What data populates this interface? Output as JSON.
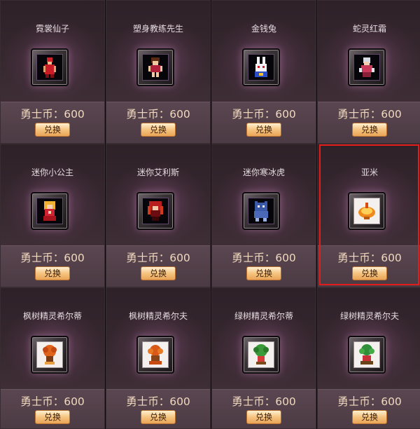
{
  "items": [
    {
      "name": "霓裳仙子",
      "price": "勇士币：600",
      "button": "兑换",
      "icon": "fairy-sprite-icon",
      "light": false
    },
    {
      "name": "塑身教练先生",
      "price": "勇士币：600",
      "button": "兑换",
      "icon": "coach-sprite-icon",
      "light": false
    },
    {
      "name": "金钱兔",
      "price": "勇士币：600",
      "button": "兑换",
      "icon": "rabbit-sprite-icon",
      "light": false
    },
    {
      "name": "蛇灵红霜",
      "price": "勇士币：600",
      "button": "兑换",
      "icon": "snake-spirit-sprite-icon",
      "light": false
    },
    {
      "name": "迷你小公主",
      "price": "勇士币：600",
      "button": "兑换",
      "icon": "princess-sprite-icon",
      "light": false
    },
    {
      "name": "迷你艾利斯",
      "price": "勇士币：600",
      "button": "兑换",
      "icon": "elis-sprite-icon",
      "light": false
    },
    {
      "name": "迷你寒冰虎",
      "price": "勇士币：600",
      "button": "兑换",
      "icon": "ice-tiger-sprite-icon",
      "light": false
    },
    {
      "name": "亚米",
      "price": "勇士币：600",
      "button": "兑换",
      "icon": "yami-sprite-icon",
      "light": true
    },
    {
      "name": "枫树精灵希尔蒂",
      "price": "勇士币：600",
      "button": "兑换",
      "icon": "maple-spirit-sprite-icon",
      "light": true
    },
    {
      "name": "枫树精灵希尔夫",
      "price": "勇士币：600",
      "button": "兑换",
      "icon": "maple-spirit-sprite-icon",
      "light": true
    },
    {
      "name": "绿树精灵希尔蒂",
      "price": "勇士币：600",
      "button": "兑换",
      "icon": "green-tree-spirit-sprite-icon",
      "light": true
    },
    {
      "name": "绿树精灵希尔夫",
      "price": "勇士币：600",
      "button": "兑换",
      "icon": "green-tree-spirit-sprite-icon",
      "light": true
    }
  ],
  "selected_index": 7,
  "colors": {
    "highlight": "#e21b1b",
    "price": "#f1d9bf",
    "button": "#f6c480"
  }
}
